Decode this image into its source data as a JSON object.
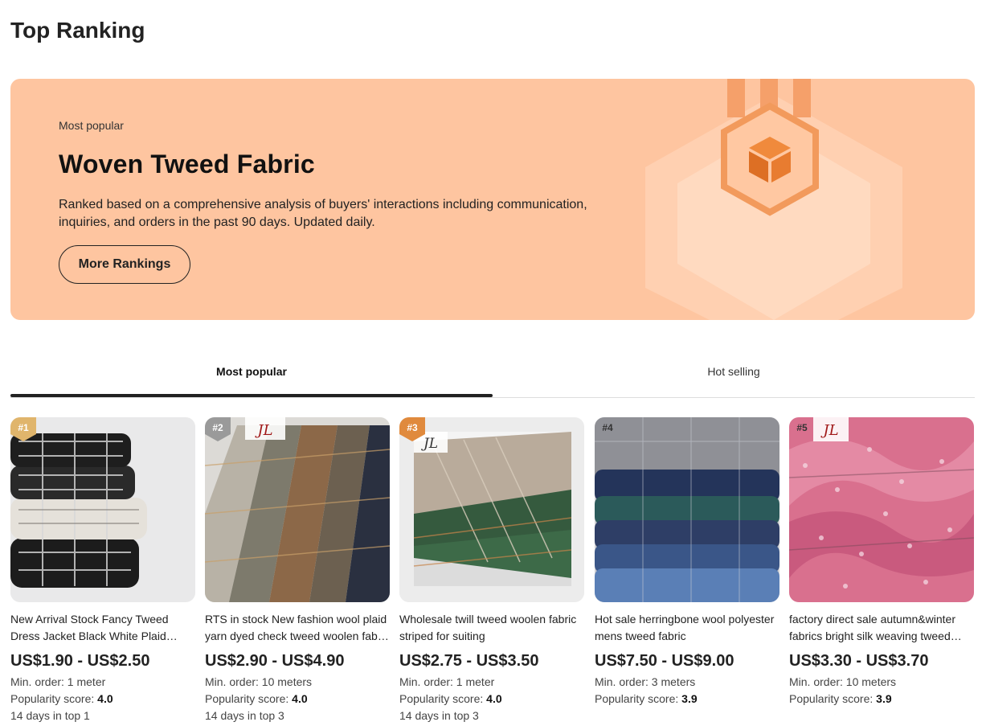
{
  "page": {
    "title": "Top Ranking"
  },
  "banner": {
    "kicker": "Most popular",
    "title": "Woven Tweed Fabric",
    "description": "Ranked based on a comprehensive analysis of buyers' interactions including communication, inquiries, and orders in the past 90 days. Updated daily.",
    "button_label": "More Rankings",
    "background_color": "#fec5a0"
  },
  "tabs": [
    {
      "label": "Most popular",
      "active": true
    },
    {
      "label": "Hot selling",
      "active": false
    }
  ],
  "products": [
    {
      "rank": "#1",
      "title": "New Arrival Stock Fancy Tweed Dress Jacket Black White Plaid Houndstooth Tweed Fabric",
      "price": "US$1.90 - US$2.50",
      "min_order": "Min. order: 1 meter",
      "popularity_label": "Popularity score:",
      "popularity_value": "4.0",
      "days_in_top": "14 days in top 1"
    },
    {
      "rank": "#2",
      "title": "RTS in stock New fashion wool plaid yarn dyed check tweed woolen fabric for coat",
      "price": "US$2.90 - US$4.90",
      "min_order": "Min. order: 10 meters",
      "popularity_label": "Popularity score:",
      "popularity_value": "4.0",
      "days_in_top": "14 days in top 3"
    },
    {
      "rank": "#3",
      "title": "Wholesale twill tweed woolen fabric striped for suiting",
      "price": "US$2.75 - US$3.50",
      "min_order": "Min. order: 1 meter",
      "popularity_label": "Popularity score:",
      "popularity_value": "4.0",
      "days_in_top": "14 days in top 3"
    },
    {
      "rank": "#4",
      "title": "Hot sale herringbone wool polyester mens tweed fabric",
      "price": "US$7.50 - US$9.00",
      "min_order": "Min. order: 3 meters",
      "popularity_label": "Popularity score:",
      "popularity_value": "3.9",
      "days_in_top": ""
    },
    {
      "rank": "#5",
      "title": "factory direct sale autumn&winter fabrics bright silk weaving tweed fabric for coat",
      "price": "US$3.30 - US$3.70",
      "min_order": "Min. order: 10 meters",
      "popularity_label": "Popularity score:",
      "popularity_value": "3.9",
      "days_in_top": ""
    }
  ]
}
